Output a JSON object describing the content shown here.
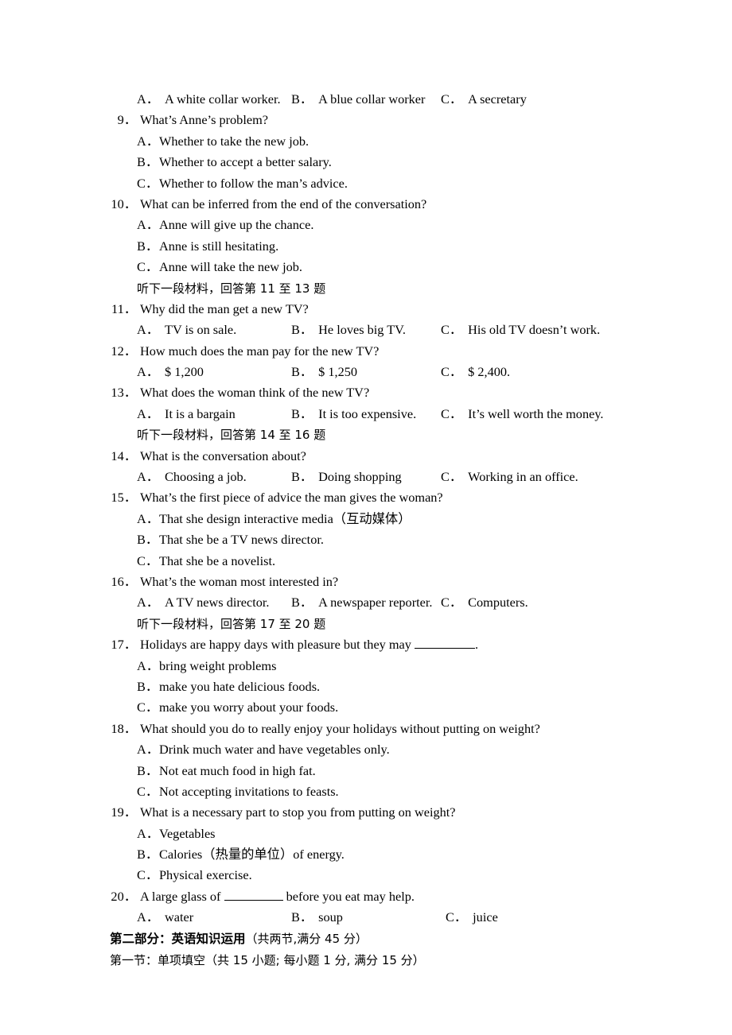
{
  "document": {
    "lines": [
      {
        "kind": "optrow",
        "name": "q8-options",
        "a_label": "A．",
        "a_text": "A white collar worker.",
        "b_label": "B．",
        "b_text": "A blue collar worker",
        "c_label": "C．",
        "c_text": "A secretary"
      },
      {
        "kind": "question",
        "name": "question-9",
        "num": "9．",
        "text": "What’s Anne’s problem?"
      },
      {
        "kind": "option",
        "name": "q9-option-a",
        "label": "A．",
        "text": "Whether to take the new job."
      },
      {
        "kind": "option",
        "name": "q9-option-b",
        "label": "B．",
        "text": "Whether to accept a better salary."
      },
      {
        "kind": "option",
        "name": "q9-option-c",
        "label": "C．",
        "text": "Whether to follow the man’s advice."
      },
      {
        "kind": "question",
        "name": "question-10",
        "num": "10．",
        "text": "What can be inferred from the end of the conversation?"
      },
      {
        "kind": "option",
        "name": "q10-option-a",
        "label": "A．",
        "text": "Anne will give up the chance."
      },
      {
        "kind": "option",
        "name": "q10-option-b",
        "label": "B．",
        "text": "Anne is still hesitating."
      },
      {
        "kind": "option",
        "name": "q10-option-c",
        "label": "C．",
        "text": "Anne will take the new job."
      },
      {
        "kind": "chinese",
        "name": "listening-instruction-11-13",
        "text": "听下一段材料，回答第 11 至 13 题"
      },
      {
        "kind": "question",
        "name": "question-11",
        "num": "11．",
        "text": "Why did the man get a new TV?"
      },
      {
        "kind": "optrow",
        "name": "q11-options",
        "a_label": "A．",
        "a_text": "TV is on sale.",
        "b_label": "B．",
        "b_text": "He loves big TV.",
        "c_label": "C．",
        "c_text": "His old TV doesn’t work."
      },
      {
        "kind": "question",
        "name": "question-12",
        "num": "12．",
        "text": "How much does the man pay for the new TV?"
      },
      {
        "kind": "optrow",
        "name": "q12-options",
        "a_label": "A．",
        "a_text": "$ 1,200",
        "b_label": "B．",
        "b_text": "$ 1,250",
        "c_label": "C．",
        "c_text": "$ 2,400."
      },
      {
        "kind": "question",
        "name": "question-13",
        "num": "13．",
        "text": "What does the woman think of the new TV?"
      },
      {
        "kind": "optrow",
        "name": "q13-options",
        "a_label": "A．",
        "a_text": "It is a bargain",
        "b_label": "B．",
        "b_text": "It is too expensive.",
        "c_label": "C．",
        "c_text": "It’s well worth the money."
      },
      {
        "kind": "chinese",
        "name": "listening-instruction-14-16",
        "text": "听下一段材料，回答第 14 至 16 题"
      },
      {
        "kind": "question",
        "name": "question-14",
        "num": "14．",
        "text": "What is the conversation about?"
      },
      {
        "kind": "optrow",
        "name": "q14-options",
        "a_label": "A．",
        "a_text": "Choosing a job.",
        "b_label": "B．",
        "b_text": "Doing shopping",
        "c_label": "C．",
        "c_text": "Working in an office."
      },
      {
        "kind": "question",
        "name": "question-15",
        "num": "15．",
        "text": "What’s the first piece of advice the man gives the woman?"
      },
      {
        "kind": "option",
        "name": "q15-option-a",
        "label": "A．",
        "text": "That she design interactive media（互动媒体）"
      },
      {
        "kind": "option",
        "name": "q15-option-b",
        "label": "B．",
        "text": "That she be a TV news director."
      },
      {
        "kind": "option",
        "name": "q15-option-c",
        "label": "C．",
        "text": "That she be a novelist."
      },
      {
        "kind": "question",
        "name": "question-16",
        "num": "16．",
        "text": "What’s the woman most interested in?"
      },
      {
        "kind": "optrow",
        "name": "q16-options",
        "a_label": "A．",
        "a_text": "A TV news director.",
        "b_label": "B．",
        "b_text": "A newspaper reporter.",
        "c_label": "C．",
        "c_text": "Computers."
      },
      {
        "kind": "chinese",
        "name": "listening-instruction-17-20",
        "text": "听下一段材料，回答第 17 至 20 题"
      },
      {
        "kind": "question-blank-17",
        "name": "question-17",
        "num": "17．",
        "text_before": "Holidays are happy days with pleasure but they may ",
        "text_after": "."
      },
      {
        "kind": "option",
        "name": "q17-option-a",
        "label": "A．",
        "text": "bring weight problems"
      },
      {
        "kind": "option",
        "name": "q17-option-b",
        "label": "B．",
        "text": "make you hate delicious foods."
      },
      {
        "kind": "option",
        "name": "q17-option-c",
        "label": "C．",
        "text": "make you worry about your foods."
      },
      {
        "kind": "question",
        "name": "question-18",
        "num": "18．",
        "text": "What should you do to really enjoy your holidays without putting on weight?"
      },
      {
        "kind": "option",
        "name": "q18-option-a",
        "label": "A．",
        "text": "Drink much water and have vegetables only."
      },
      {
        "kind": "option",
        "name": "q18-option-b",
        "label": "B．",
        "text": "Not eat much food in high fat."
      },
      {
        "kind": "option",
        "name": "q18-option-c",
        "label": "C．",
        "text": "Not accepting invitations to feasts."
      },
      {
        "kind": "question",
        "name": "question-19",
        "num": "19．",
        "text": "What is a necessary part to stop you from putting on weight?"
      },
      {
        "kind": "option",
        "name": "q19-option-a",
        "label": "A．",
        "text": "Vegetables"
      },
      {
        "kind": "option",
        "name": "q19-option-b",
        "label": "B．",
        "text": "Calories（热量的单位）of energy."
      },
      {
        "kind": "option",
        "name": "q19-option-c",
        "label": "C．",
        "text": "Physical exercise."
      },
      {
        "kind": "question-blank-20",
        "name": "question-20",
        "num": "20．",
        "text_before": "A large glass of ",
        "text_after": " before you eat may help."
      },
      {
        "kind": "optrow-wide",
        "name": "q20-options",
        "a_label": "A．",
        "a_text": "water",
        "b_label": "B．",
        "b_text": "soup",
        "c_label": "C．",
        "c_text": "juice"
      },
      {
        "kind": "section-bold",
        "name": "part-two-heading",
        "bold_text": "第二部分：英语知识运用",
        "reg_text": "（共两节,满分 45 分）"
      },
      {
        "kind": "section-reg",
        "name": "section-one-heading",
        "reg_text": "第一节：单项填空（共 15 小题; 每小题 1 分, 满分 15 分）"
      }
    ]
  }
}
